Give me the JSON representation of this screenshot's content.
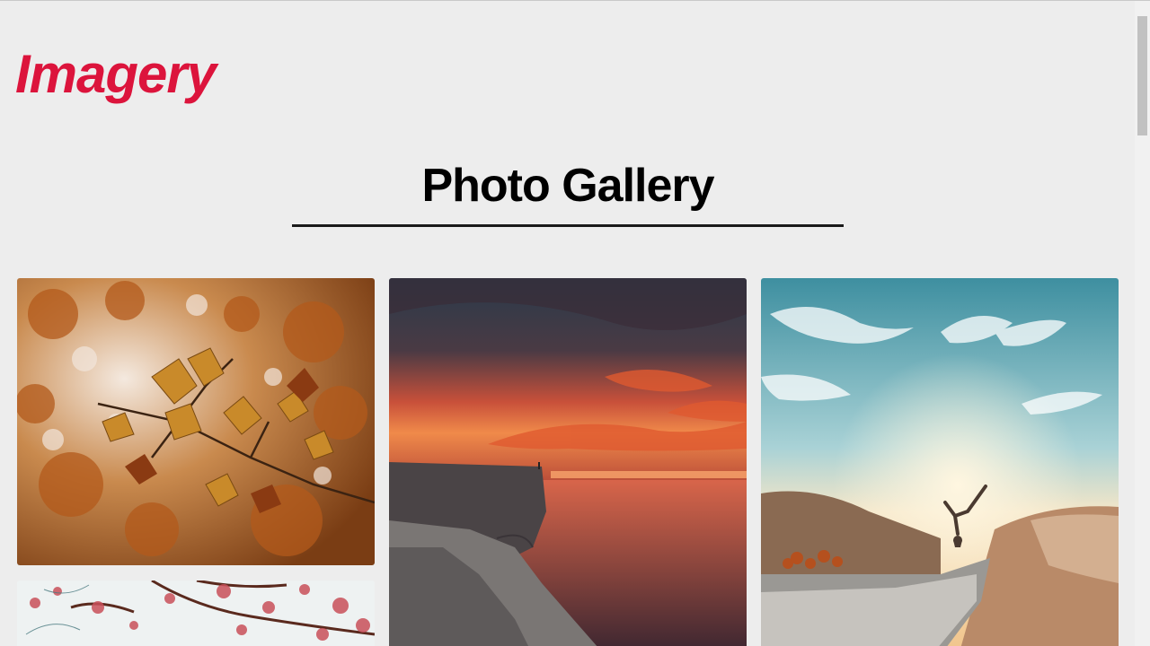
{
  "brand": {
    "logo": "Imagery",
    "color": "#dc143c"
  },
  "heading": {
    "strong": "Photo",
    "light": " Gallery"
  },
  "gallery": {
    "items": [
      {
        "subject": "autumn leaves"
      },
      {
        "subject": "blossoming branches"
      },
      {
        "subject": "ocean cliff at sunset"
      },
      {
        "subject": "handstand on cliff edge"
      }
    ]
  }
}
